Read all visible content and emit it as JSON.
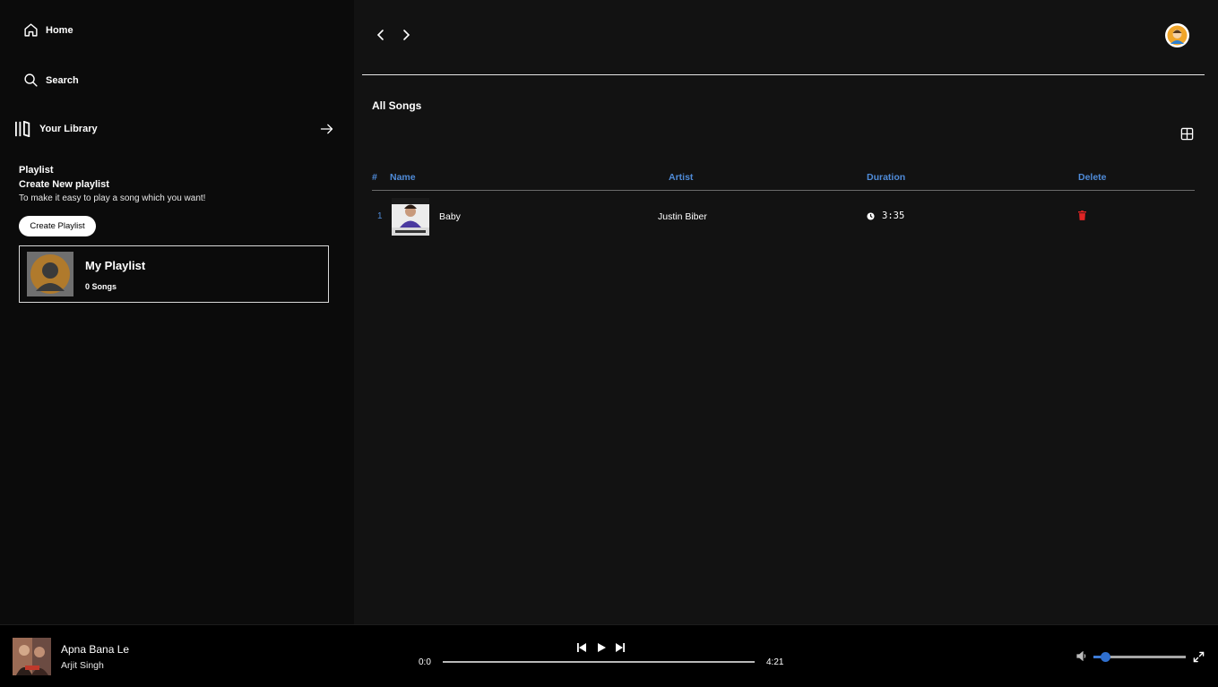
{
  "sidebar": {
    "home_label": "Home",
    "search_label": "Search",
    "library_label": "Your Library",
    "playlist_heading": "Playlist",
    "create_heading": "Create New playlist",
    "create_description": "To make it easy to play a song which you want!",
    "create_button_label": "Create Playlist",
    "playlists": [
      {
        "name": "My Playlist",
        "count": "0 Songs"
      }
    ]
  },
  "main": {
    "section_title": "All Songs",
    "columns": [
      "#",
      "Name",
      "Artist",
      "Duration",
      "Delete"
    ],
    "songs": [
      {
        "index": "1",
        "name": "Baby",
        "artist": "Justin Biber",
        "duration": "3:35"
      }
    ]
  },
  "player": {
    "title": "Apna Bana Le",
    "artist": "Arjit Singh",
    "current_time": "0:0",
    "total_time": "4:21",
    "progress": 0,
    "volume": 0.13
  },
  "colors": {
    "accent": "#4f8bd8",
    "delete": "#e02424",
    "volume": "#2f6fcf",
    "background": "#121212",
    "sidebar": "#0b0b0b"
  },
  "icons": {
    "home": "home-icon",
    "search": "search-icon",
    "library": "library-icon",
    "arrow": "arrow-right-icon",
    "grid": "grid-icon",
    "trash": "trash-icon",
    "clock": "clock-icon",
    "prev": "skip-previous-icon",
    "play": "play-icon",
    "next": "skip-next-icon",
    "volume": "volume-icon",
    "expand": "expand-icon"
  }
}
